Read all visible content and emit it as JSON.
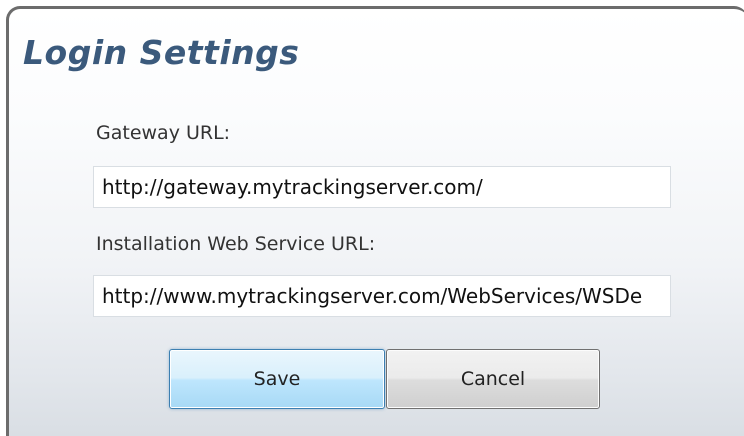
{
  "dialog": {
    "title": "Login Settings"
  },
  "gateway": {
    "label": "Gateway URL:",
    "value": "http://gateway.mytrackingserver.com/"
  },
  "web_service": {
    "label": "Installation Web Service URL:",
    "value": "http://www.mytrackingserver.com/WebServices/WSDe"
  },
  "buttons": {
    "save_label": "Save",
    "cancel_label": "Cancel"
  },
  "colors": {
    "title": "#3b5a7c",
    "save_border": "#3c7fb1",
    "cancel_border": "#707070",
    "dialog_border": "#6c6c6c"
  }
}
